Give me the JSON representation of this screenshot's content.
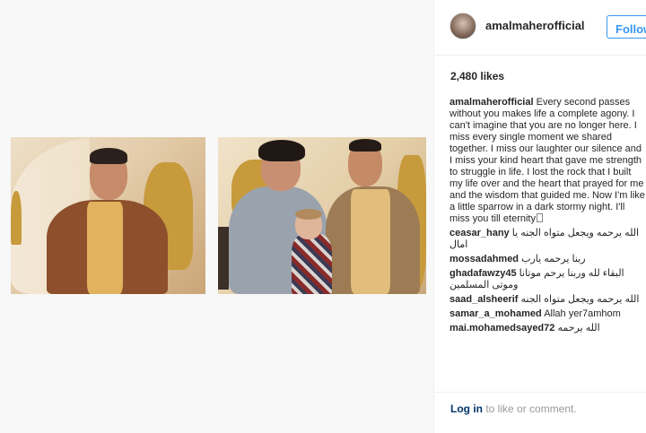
{
  "post": {
    "username": "amalmaherofficial",
    "follow_label": "Follow",
    "likes": "2,480 likes",
    "caption_user": "amalmaherofficial",
    "caption_text": "Every second passes without you makes life a complete agony. I can't imagine that you are no longer here. I miss every single moment we shared together. I miss our laughter our silence and I miss your kind heart that gave me strength to struggle in life. I lost the rock that I built my life over and the heart that prayed for me and the wisdom that guided me. Now I'm like a little sparrow in a dark stormy night. I'll miss you till eternity"
  },
  "comments": [
    {
      "user": "ceasar_hany",
      "text": "الله يرحمه ويجعل متواه الجنه يا امال"
    },
    {
      "user": "mossadahmed",
      "text": "ربنا يرحمه يارب"
    },
    {
      "user": "ghadafawzy45",
      "text": "البقاء لله وربنا يرحم موتانا وموتى المسلمين"
    },
    {
      "user": "saad_alsheerif",
      "text": "الله يرحمه ويجعل متواه الجنه"
    },
    {
      "user": "samar_a_mohamed",
      "text": "Allah yer7amhom"
    },
    {
      "user": "mai.mohamedsayed72",
      "text": "الله يرحمه"
    }
  ],
  "footer": {
    "login_link": "Log in",
    "login_rest": " to like or comment."
  }
}
